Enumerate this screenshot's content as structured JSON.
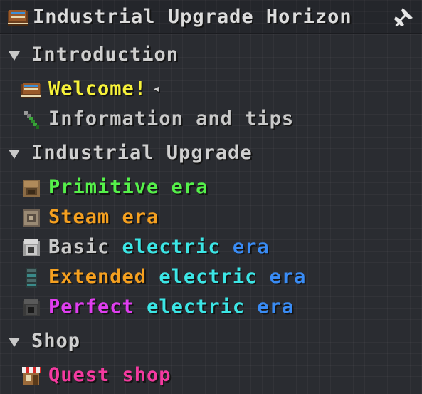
{
  "header": {
    "title": "Industrial Upgrade Horizon",
    "book_icon": "book-icon",
    "pin_icon": "pin-icon"
  },
  "categories": [
    {
      "label": "Introduction",
      "items": [
        {
          "parts": [
            "Welcome!"
          ],
          "icon": "book-icon",
          "speaker": "◂"
        },
        {
          "parts": [
            "Information and tips"
          ],
          "icon": "wrench-icon"
        }
      ]
    },
    {
      "label": "Industrial Upgrade",
      "items": [
        {
          "parts": [
            "Primitive era"
          ],
          "icon": "primitive-machine-icon"
        },
        {
          "parts": [
            "Steam era"
          ],
          "icon": "steam-machine-icon"
        },
        {
          "parts": [
            "Basic",
            "electric",
            "era"
          ],
          "icon": "basic-machine-icon"
        },
        {
          "parts": [
            "Extended",
            "electric",
            "era"
          ],
          "icon": "extended-machine-icon"
        },
        {
          "parts": [
            "Perfect",
            "electric",
            "era"
          ],
          "icon": "perfect-machine-icon"
        }
      ]
    },
    {
      "label": "Shop",
      "items": [
        {
          "parts": [
            "Quest shop"
          ],
          "icon": "shop-icon"
        }
      ]
    }
  ],
  "colors": {
    "background": "#2a2c31",
    "yellow": "#f7f23a",
    "green": "#55f04a",
    "orange": "#f5a020",
    "cyan": "#3ce6e6",
    "blue": "#3a8cf5",
    "magenta": "#e03ef0",
    "pink": "#f43aa0"
  }
}
